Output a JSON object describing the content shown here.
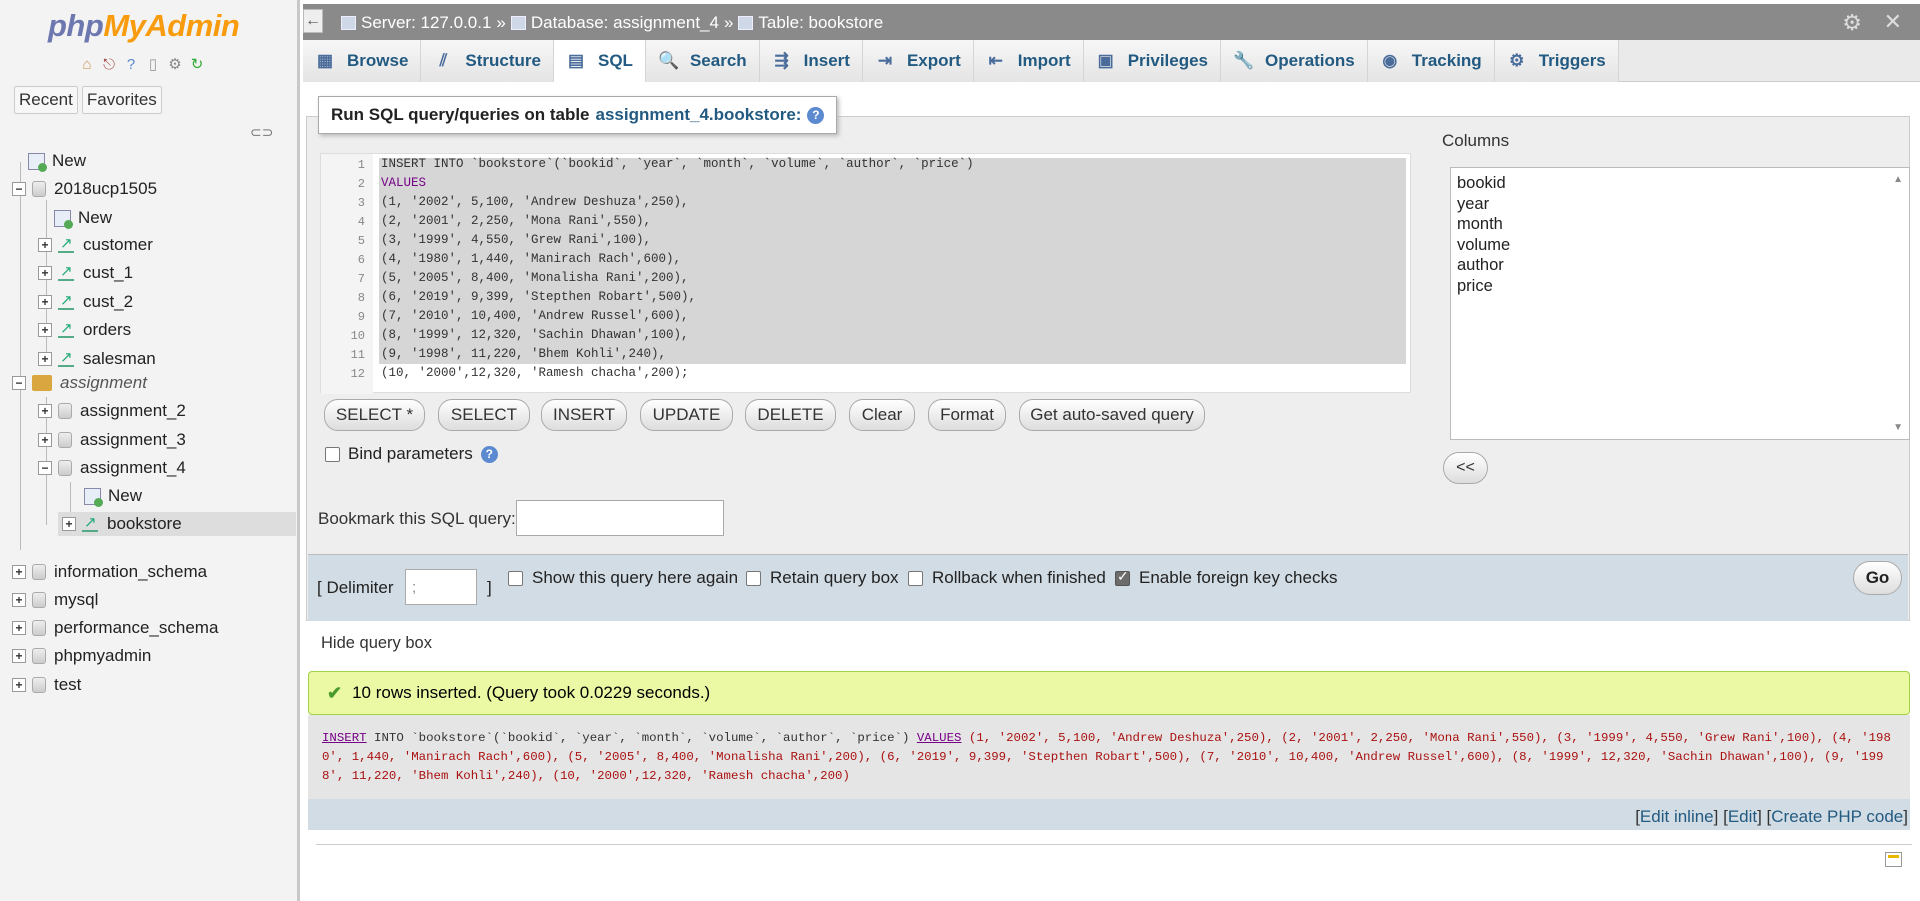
{
  "logo": {
    "php": "php",
    "myadmin": "MyAdmin"
  },
  "nav": {
    "tabs": [
      "Recent",
      "Favorites"
    ],
    "icons": [
      "home-icon",
      "exit-icon",
      "help-icon",
      "docs-icon",
      "settings-icon",
      "reload-icon"
    ],
    "tree": {
      "new_root": "New",
      "db_2018": "2018ucp1505",
      "db_2018_new": "New",
      "customer": "customer",
      "cust_1": "cust_1",
      "cust_2": "cust_2",
      "orders": "orders",
      "salesman": "salesman",
      "group_assignment": "assignment",
      "assignment_2": "assignment_2",
      "assignment_3": "assignment_3",
      "assignment_4": "assignment_4",
      "assignment_4_new": "New",
      "bookstore": "bookstore",
      "information_schema": "information_schema",
      "mysql": "mysql",
      "performance_schema": "performance_schema",
      "phpmyadmin": "phpmyadmin",
      "test": "test"
    }
  },
  "topbar": {
    "collapse": "←",
    "server": "Server: 127.0.0.1",
    "sep1": "»",
    "database": "Database: assignment_4",
    "sep2": "»",
    "table": "Table: bookstore"
  },
  "tabs": [
    {
      "label": "Browse",
      "icon": "▦"
    },
    {
      "label": "Structure",
      "icon": "⫽"
    },
    {
      "label": "SQL",
      "icon": "▤"
    },
    {
      "label": "Search",
      "icon": "🔍"
    },
    {
      "label": "Insert",
      "icon": "⇶"
    },
    {
      "label": "Export",
      "icon": "⇥"
    },
    {
      "label": "Import",
      "icon": "⇤"
    },
    {
      "label": "Privileges",
      "icon": "▣"
    },
    {
      "label": "Operations",
      "icon": "🔧"
    },
    {
      "label": "Tracking",
      "icon": "◉"
    },
    {
      "label": "Triggers",
      "icon": "⚙"
    }
  ],
  "query": {
    "legend_prefix": "Run SQL query/queries on table ",
    "legend_table": "assignment_4.bookstore:",
    "code_lines": [
      "INSERT INTO `bookstore`(`bookid`, `year`, `month`, `volume`, `author`, `price`)",
      "VALUES",
      "(1, '2002', 5,100, 'Andrew Deshuza',250),",
      "(2, '2001', 2,250, 'Mona Rani',550),",
      "(3, '1999', 4,550, 'Grew Rani',100),",
      "(4, '1980', 1,440, 'Manirach Rach',600),",
      "(5, '2005', 8,400, 'Monalisha Rani',200),",
      "(6, '2019', 9,399, 'Stepthen Robart',500),",
      "(7, '2010', 10,400, 'Andrew Russel',600),",
      "(8, '1999', 12,320, 'Sachin Dhawan',100),",
      "(9, '1998', 11,220, 'Bhem Kohli',240),",
      "(10, '2000',12,320, 'Ramesh chacha',200);"
    ],
    "line_numbers": [
      "1",
      "2",
      "3",
      "4",
      "5",
      "6",
      "7",
      "8",
      "9",
      "10",
      "11",
      "12"
    ],
    "buttons": [
      "SELECT *",
      "SELECT",
      "INSERT",
      "UPDATE",
      "DELETE",
      "Clear",
      "Format",
      "Get auto-saved query"
    ],
    "bind_params": "Bind parameters",
    "columns_label": "Columns",
    "columns": [
      "bookid",
      "year",
      "month",
      "volume",
      "author",
      "price"
    ],
    "insert_col_btn": "<<",
    "bookmark_label": "Bookmark this SQL query:",
    "bookmark_value": "",
    "delimiter_label": "[ Delimiter",
    "delimiter_value": ";",
    "delimiter_end": "]",
    "options": [
      {
        "label": "Show this query here again",
        "checked": false
      },
      {
        "label": "Retain query box",
        "checked": false
      },
      {
        "label": "Rollback when finished",
        "checked": false
      },
      {
        "label": "Enable foreign key checks",
        "checked": true
      }
    ],
    "go": "Go",
    "hide_query_box": "Hide query box"
  },
  "result": {
    "message": "10 rows inserted. (Query took 0.0229 seconds.)",
    "sql_insert": "INSERT",
    "sql_into": " INTO `bookstore`(`bookid`, `year`, `month`, `volume`, `author`, `price`) ",
    "sql_values": "VALUES",
    "sql_rest": " (1, '2002', 5,100, 'Andrew Deshuza',250), (2, '2001', 2,250, 'Mona Rani',550), (3, '1999', 4,550, 'Grew Rani',100), (4, '1980', 1,440, 'Manirach Rach',600), (5, '2005', 8,400, 'Monalisha Rani',200), (6, '2019', 9,399, 'Stepthen Robart',500), (7, '2010', 10,400, 'Andrew Russel',600), (8, '1999', 12,320, 'Sachin Dhawan',100), (9, '1998', 11,220, 'Bhem Kohli',240), (10, '2000',12,320, 'Ramesh chacha',200)",
    "links": {
      "open1": "[",
      "edit_inline": "Edit inline",
      "sep1": "] [",
      "edit": "Edit",
      "sep2": "] [",
      "create_php": "Create PHP code",
      "close": "]"
    }
  }
}
